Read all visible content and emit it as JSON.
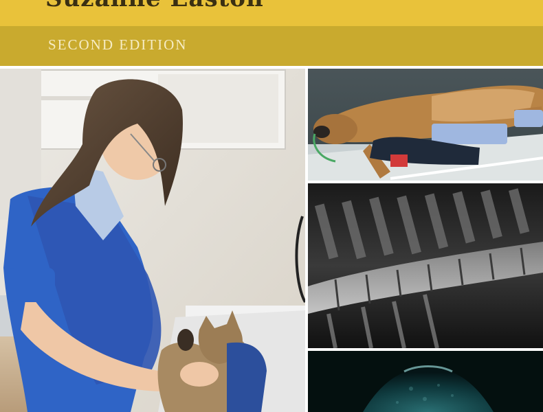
{
  "cover": {
    "author": "Suzanne Easton",
    "edition": "SECOND EDITION"
  },
  "colors": {
    "title_band": "#e9c23a",
    "edition_band": "#c9aa2e",
    "edition_text": "#f6ecc4"
  },
  "images": [
    {
      "name": "vet-with-cat-photo"
    },
    {
      "name": "anesthetized-dog-photo"
    },
    {
      "name": "spine-xray-photo"
    },
    {
      "name": "ultrasound-scan-photo"
    }
  ]
}
